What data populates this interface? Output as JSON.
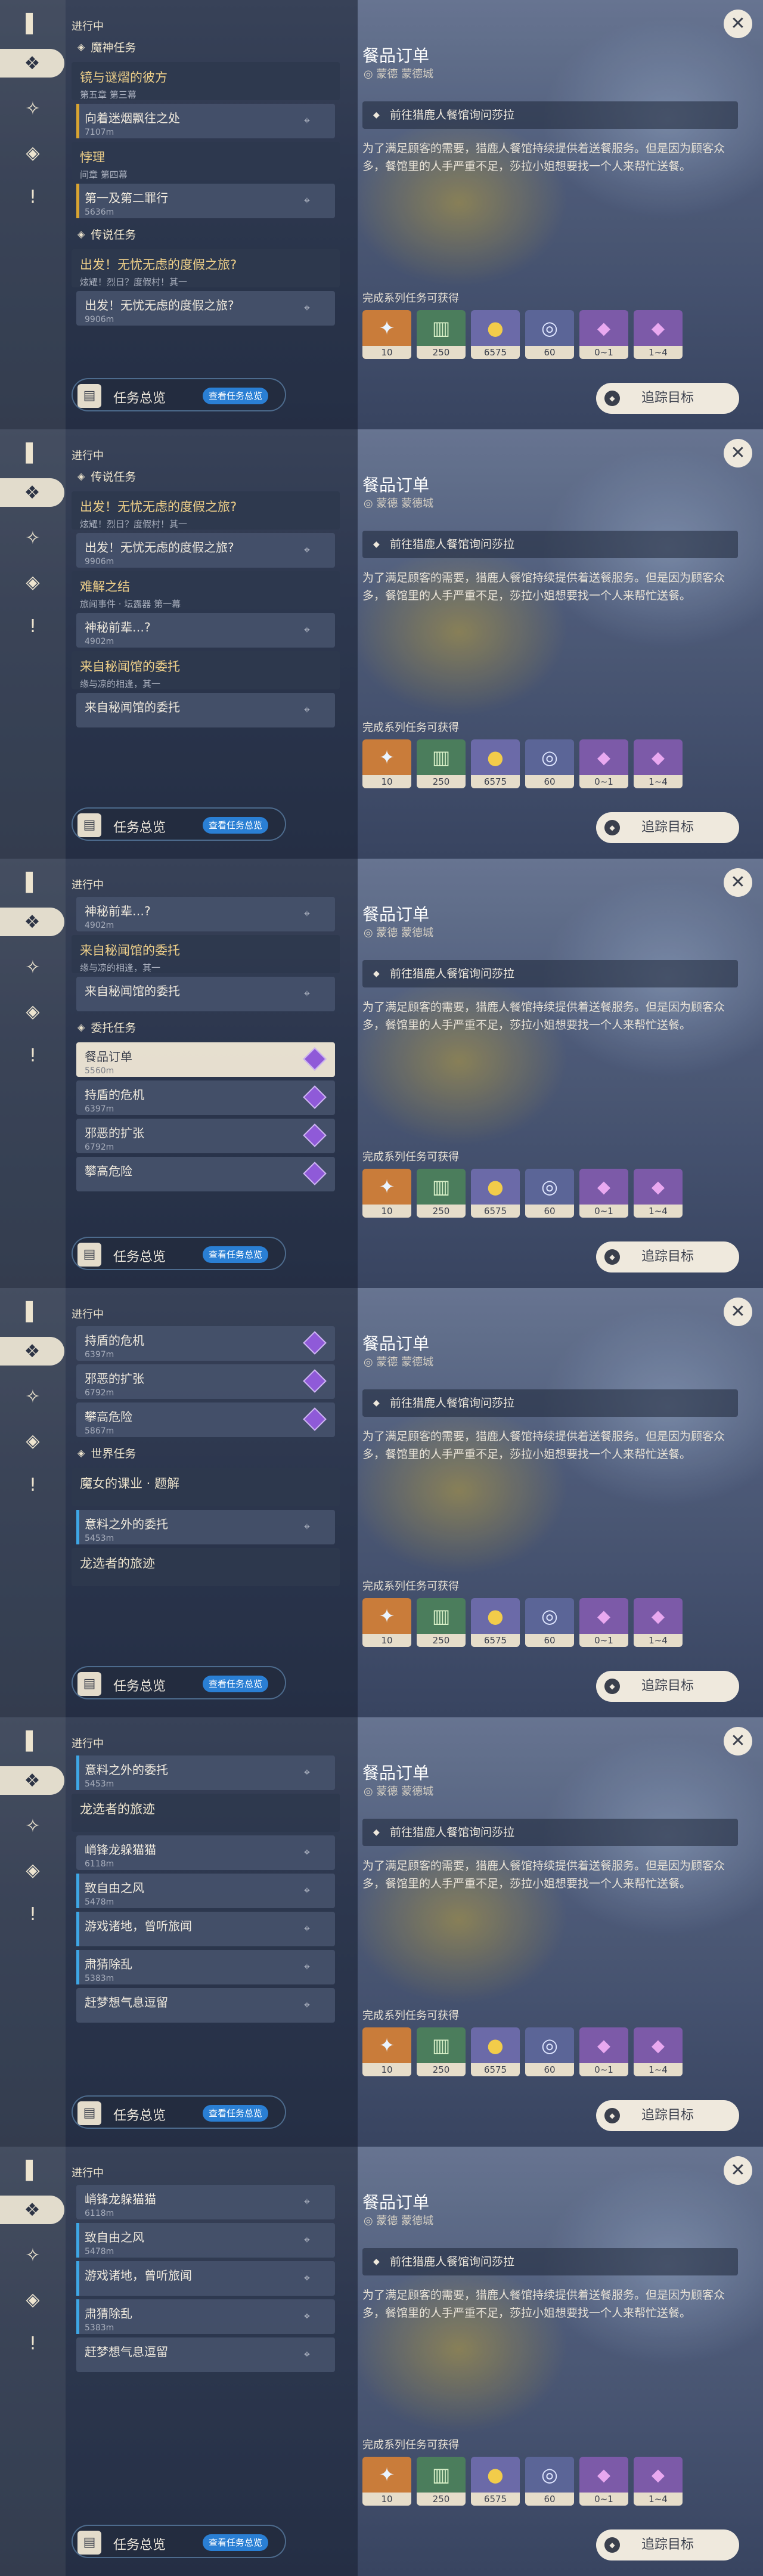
{
  "common": {
    "in_progress": "进行中",
    "overview_label": "任务总览",
    "overview_chip": "查看任务总览",
    "close_glyph": "✕",
    "detail_title": "餐品订单",
    "detail_location": "◎ 蒙德  蒙德城",
    "objective": "前往猎鹿人餐馆询问莎拉",
    "description": "为了满足顾客的需要，猎鹿人餐馆持续提供着送餐服务。但是因为顾客众多，餐馆里的人手严重不足，莎拉小姐想要找一个人来帮忙送餐。",
    "rewards_label": "完成系列任务可获得",
    "rewards": [
      {
        "count": "10",
        "icon": "star-crystal",
        "color": "orange"
      },
      {
        "count": "250",
        "icon": "exp-book",
        "color": "green"
      },
      {
        "count": "6575",
        "icon": "mora-coin",
        "color": "gold"
      },
      {
        "count": "60",
        "icon": "ring-token",
        "color": "blue"
      },
      {
        "count": "0~1",
        "icon": "purple-crystal",
        "color": "purple"
      },
      {
        "count": "1~4",
        "icon": "purple-crystal",
        "color": "purple"
      }
    ],
    "track_label": "追踪目标",
    "track_dot": "◆"
  },
  "panels": [
    {
      "list": [
        {
          "kind": "sec",
          "glyph": "◈",
          "text": "魔神任务"
        },
        {
          "kind": "grp",
          "title": "镜与谜熠的彼方",
          "sub": "第五章 第三幕"
        },
        {
          "kind": "item",
          "title": "向着迷烟飘往之处",
          "sub": "7107m",
          "bar": "gold"
        },
        {
          "kind": "grp",
          "title": "悖理",
          "sub": "间章 第四幕"
        },
        {
          "kind": "item",
          "title": "第一及第二罪行",
          "sub": "5636m",
          "bar": "gold"
        },
        {
          "kind": "sec",
          "glyph": "◈",
          "text": "传说任务"
        },
        {
          "kind": "grp",
          "title": "出发！无忧无虑的度假之旅?",
          "sub": "炫耀！烈日？度假村！其一"
        },
        {
          "kind": "item",
          "title": "出发！无忧无虑的度假之旅?",
          "sub": "9906m",
          "bar": "none"
        }
      ]
    },
    {
      "list": [
        {
          "kind": "sec",
          "glyph": "◈",
          "text": "传说任务"
        },
        {
          "kind": "grp",
          "title": "出发！无忧无虑的度假之旅?",
          "sub": "炫耀！烈日？度假村！其一"
        },
        {
          "kind": "item",
          "title": "出发！无忧无虑的度假之旅?",
          "sub": "9906m",
          "bar": "none"
        },
        {
          "kind": "grp",
          "title": "难解之结",
          "sub": "旅闻事件 · 坛露器 第一幕"
        },
        {
          "kind": "item",
          "title": "神秘前辈…?",
          "sub": "4902m",
          "bar": "none"
        },
        {
          "kind": "grp",
          "title": "来自秘闻馆的委托",
          "sub": "缘与凉的相逢，其一"
        },
        {
          "kind": "item",
          "title": "来自秘闻馆的委托",
          "sub": "",
          "bar": "none"
        }
      ]
    },
    {
      "list": [
        {
          "kind": "item",
          "title": "神秘前辈…?",
          "sub": "4902m",
          "bar": "none"
        },
        {
          "kind": "grp",
          "title": "来自秘闻馆的委托",
          "sub": "缘与凉的相逢，其一"
        },
        {
          "kind": "item",
          "title": "来自秘闻馆的委托",
          "sub": "",
          "bar": "none"
        },
        {
          "kind": "sec",
          "glyph": "◈",
          "text": "委托任务"
        },
        {
          "kind": "item",
          "title": "餐品订单",
          "sub": "5560m",
          "bar": "none",
          "sel": true,
          "gem": true
        },
        {
          "kind": "item",
          "title": "持盾的危机",
          "sub": "6397m",
          "bar": "none",
          "gem": true
        },
        {
          "kind": "item",
          "title": "邪恶的扩张",
          "sub": "6792m",
          "bar": "none",
          "gem": true
        },
        {
          "kind": "item",
          "title": "攀高危险",
          "sub": "",
          "bar": "none",
          "gem": true
        }
      ]
    },
    {
      "list": [
        {
          "kind": "item",
          "title": "持盾的危机",
          "sub": "6397m",
          "bar": "none",
          "gem": true
        },
        {
          "kind": "item",
          "title": "邪恶的扩张",
          "sub": "6792m",
          "bar": "none",
          "gem": true
        },
        {
          "kind": "item",
          "title": "攀高危险",
          "sub": "5867m",
          "bar": "none",
          "gem": true
        },
        {
          "kind": "sec",
          "glyph": "◈",
          "text": "世界任务"
        },
        {
          "kind": "grp",
          "title": "魔女的课业 · 题解",
          "sub": "",
          "plain": true
        },
        {
          "kind": "item",
          "title": "意料之外的委托",
          "sub": "5453m",
          "bar": "blue"
        },
        {
          "kind": "grp",
          "title": "龙选者的旅迹",
          "sub": "",
          "plain": true
        }
      ]
    },
    {
      "list": [
        {
          "kind": "item",
          "title": "意料之外的委托",
          "sub": "5453m",
          "bar": "blue"
        },
        {
          "kind": "grp",
          "title": "龙选者的旅迹",
          "sub": "",
          "plain": true
        },
        {
          "kind": "item",
          "title": "峭锋龙躲猫猫",
          "sub": "6118m",
          "bar": "none"
        },
        {
          "kind": "item",
          "title": "致自由之风",
          "sub": "5478m",
          "bar": "blue"
        },
        {
          "kind": "item",
          "title": "游戏诸地，曾听旅闻",
          "sub": "",
          "bar": "blue"
        },
        {
          "kind": "item",
          "title": "肃猜除乱",
          "sub": "5383m",
          "bar": "blue"
        },
        {
          "kind": "item",
          "title": "赶梦想气息逗留",
          "sub": "",
          "bar": "none"
        }
      ]
    },
    {
      "list": [
        {
          "kind": "item",
          "title": "峭锋龙躲猫猫",
          "sub": "6118m",
          "bar": "none"
        },
        {
          "kind": "item",
          "title": "致自由之风",
          "sub": "5478m",
          "bar": "blue"
        },
        {
          "kind": "item",
          "title": "游戏诸地，曾听旅闻",
          "sub": "",
          "bar": "blue"
        },
        {
          "kind": "item",
          "title": "肃猜除乱",
          "sub": "5383m",
          "bar": "blue"
        },
        {
          "kind": "item",
          "title": "赶梦想气息逗留",
          "sub": "",
          "bar": "none"
        }
      ]
    }
  ],
  "sidebar_icons": [
    {
      "name": "quest-book-icon",
      "glyph": "▌"
    },
    {
      "name": "quest-diamond-icon",
      "glyph": "❖"
    },
    {
      "name": "archon-quest-icon",
      "glyph": "✧"
    },
    {
      "name": "commission-icon",
      "glyph": "◈"
    },
    {
      "name": "alert-icon",
      "glyph": "!"
    }
  ]
}
